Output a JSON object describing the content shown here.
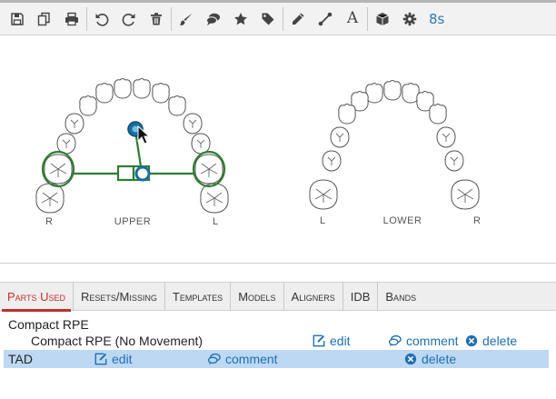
{
  "toolbar": {
    "timer": "8s",
    "text_tool_glyph": "A",
    "icons": [
      "save-icon",
      "copy-icon",
      "print-icon",
      "undo-icon",
      "redo-icon",
      "trash-icon",
      "brush-icon",
      "comment-icon",
      "star-icon",
      "tag-icon",
      "pencil-icon",
      "connector-icon",
      "text-icon",
      "box-icon",
      "gear-icon"
    ]
  },
  "arches": {
    "upper": {
      "label": "UPPER",
      "left": "R",
      "right": "L"
    },
    "lower": {
      "label": "LOWER",
      "left": "L",
      "right": "R"
    }
  },
  "colors": {
    "appliance": "#2e7d32",
    "tad": "#1a6e9e",
    "accent": "#c0302b",
    "link": "#1f6fb2",
    "selected_row": "#bdd8f2"
  },
  "tabs": [
    {
      "label": "Parts Used",
      "active": true
    },
    {
      "label": "Resets/Missing",
      "active": false
    },
    {
      "label": "Templates",
      "active": false
    },
    {
      "label": "Models",
      "active": false
    },
    {
      "label": "Aligners",
      "active": false
    },
    {
      "label": "IDB",
      "active": false
    },
    {
      "label": "Bands",
      "active": false
    }
  ],
  "parts": {
    "group_title": "Compact RPE",
    "item1": {
      "name": "Compact RPE (No Movement)",
      "edit": "edit",
      "comment": "comment",
      "delete": "delete"
    },
    "item2": {
      "name": "TAD",
      "edit": "edit",
      "comment": "comment",
      "delete": "delete"
    }
  }
}
